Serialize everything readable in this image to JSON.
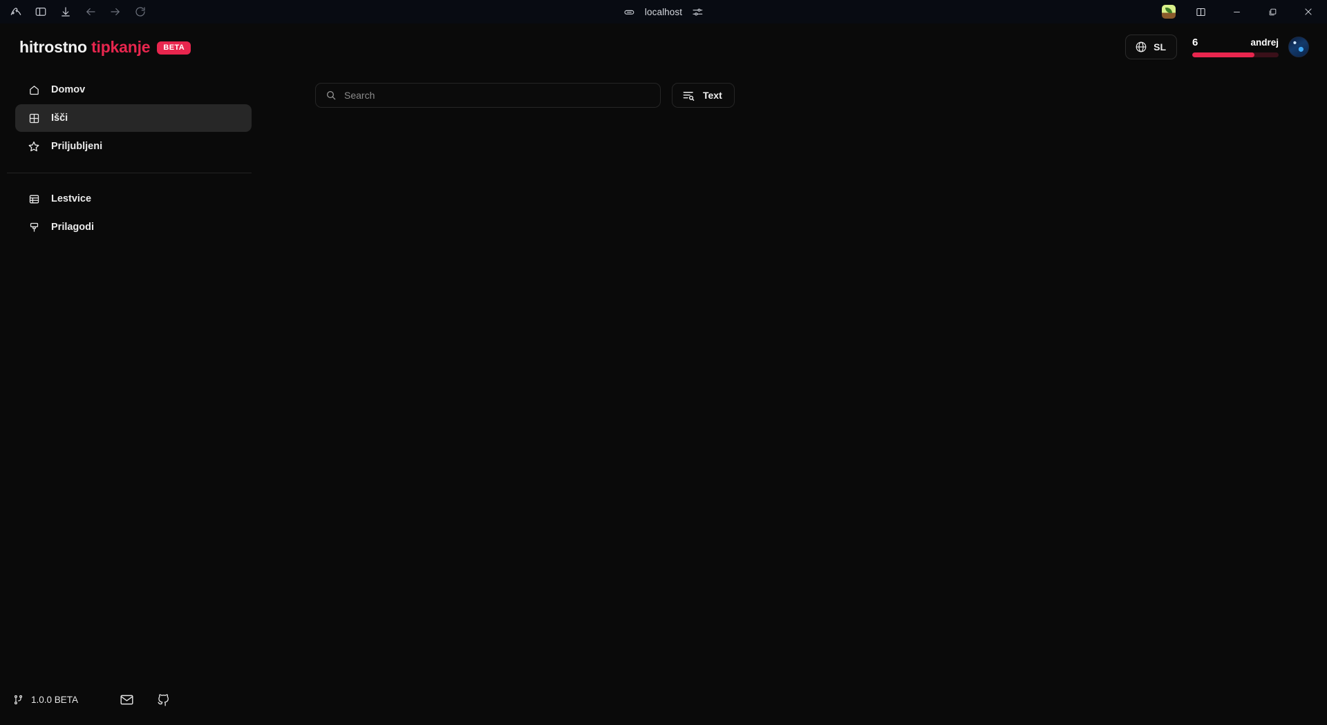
{
  "browser": {
    "url": "localhost",
    "left_controls": [
      {
        "name": "arc-logo-icon",
        "label": "Arc"
      },
      {
        "name": "sidebar-toggle-icon",
        "label": "Toggle sidebar"
      },
      {
        "name": "download-icon",
        "label": "Downloads"
      },
      {
        "name": "back-icon",
        "label": "Back"
      },
      {
        "name": "forward-icon",
        "label": "Forward"
      },
      {
        "name": "reload-icon",
        "label": "Reload"
      }
    ],
    "center_controls": [
      {
        "name": "link-icon",
        "label": "Copy link"
      },
      {
        "name": "page-settings-icon",
        "label": "Site settings"
      }
    ],
    "right_controls": [
      {
        "name": "extension-seedling-icon",
        "label": "Extension"
      },
      {
        "name": "split-view-icon",
        "label": "Split view"
      },
      {
        "name": "minimize-icon",
        "label": "Minimize"
      },
      {
        "name": "maximize-icon",
        "label": "Maximize"
      },
      {
        "name": "close-icon",
        "label": "Close"
      }
    ]
  },
  "header": {
    "logo_first": "hitrostno",
    "logo_second": "tipkanje",
    "beta_badge": "BETA",
    "language": {
      "code": "SL",
      "icon": "globe-icon"
    },
    "user": {
      "level": "6",
      "name": "andrej",
      "xp_percent": 72
    }
  },
  "sidebar": {
    "primary": [
      {
        "label": "Domov",
        "icon": "home-icon",
        "active": false
      },
      {
        "label": "Išči",
        "icon": "grid-icon",
        "active": true
      },
      {
        "label": "Priljubljeni",
        "icon": "star-icon",
        "active": false
      }
    ],
    "secondary": [
      {
        "label": "Lestvice",
        "icon": "table-icon",
        "active": false
      },
      {
        "label": "Prilagodi",
        "icon": "paintbrush-icon",
        "active": false
      }
    ],
    "footer": {
      "version": "1.0.0 BETA",
      "version_icon": "git-branch-icon",
      "links": [
        {
          "name": "mail-icon",
          "label": "Mail"
        },
        {
          "name": "github-icon",
          "label": "GitHub"
        }
      ]
    }
  },
  "main": {
    "search": {
      "placeholder": "Search",
      "value": "",
      "icon": "search-icon"
    },
    "filter_button": {
      "label": "Text",
      "icon": "text-search-icon"
    },
    "results": []
  },
  "colors": {
    "accent": "#e8264e",
    "background": "#0a0a0a",
    "chrome_background": "#080b12",
    "active_item": "#272727",
    "border": "#262626",
    "text_primary": "#ededed",
    "text_muted": "#8b8b8b",
    "xp_track": "#3a1019"
  }
}
